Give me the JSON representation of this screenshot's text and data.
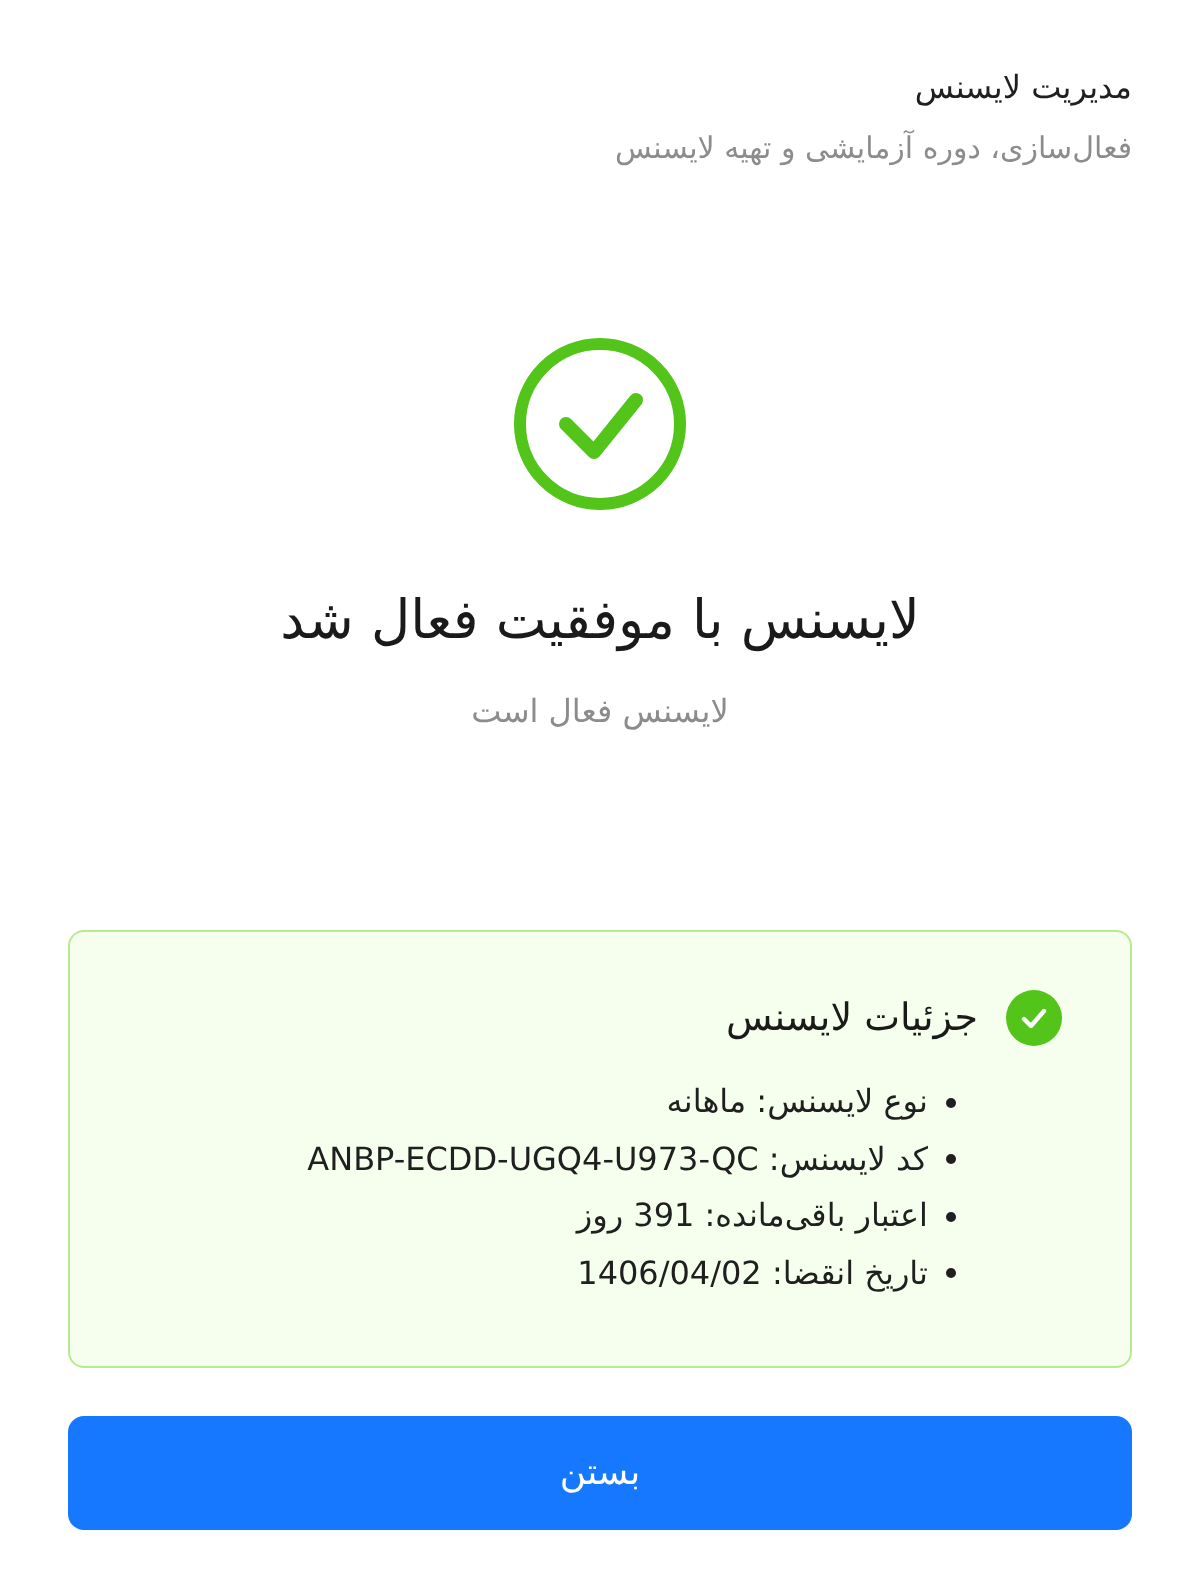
{
  "header": {
    "title": "مدیریت لایسنس",
    "subtitle": "فعال‌سازی، دوره آزمایشی و تهیه لایسنس"
  },
  "result": {
    "heading": "لایسنس با موفقیت فعال شد",
    "message": "لایسنس فعال است"
  },
  "details": {
    "title": "جزئیات لایسنس",
    "items": [
      "نوع لایسنس: ماهانه",
      "کد لایسنس: ANBP-ECDD-UGQ4-U973-QC",
      "اعتبار باقی‌مانده: 391 روز",
      "تاریخ انقضا: 1406/04/02"
    ]
  },
  "close_button": {
    "label": "بستن"
  }
}
